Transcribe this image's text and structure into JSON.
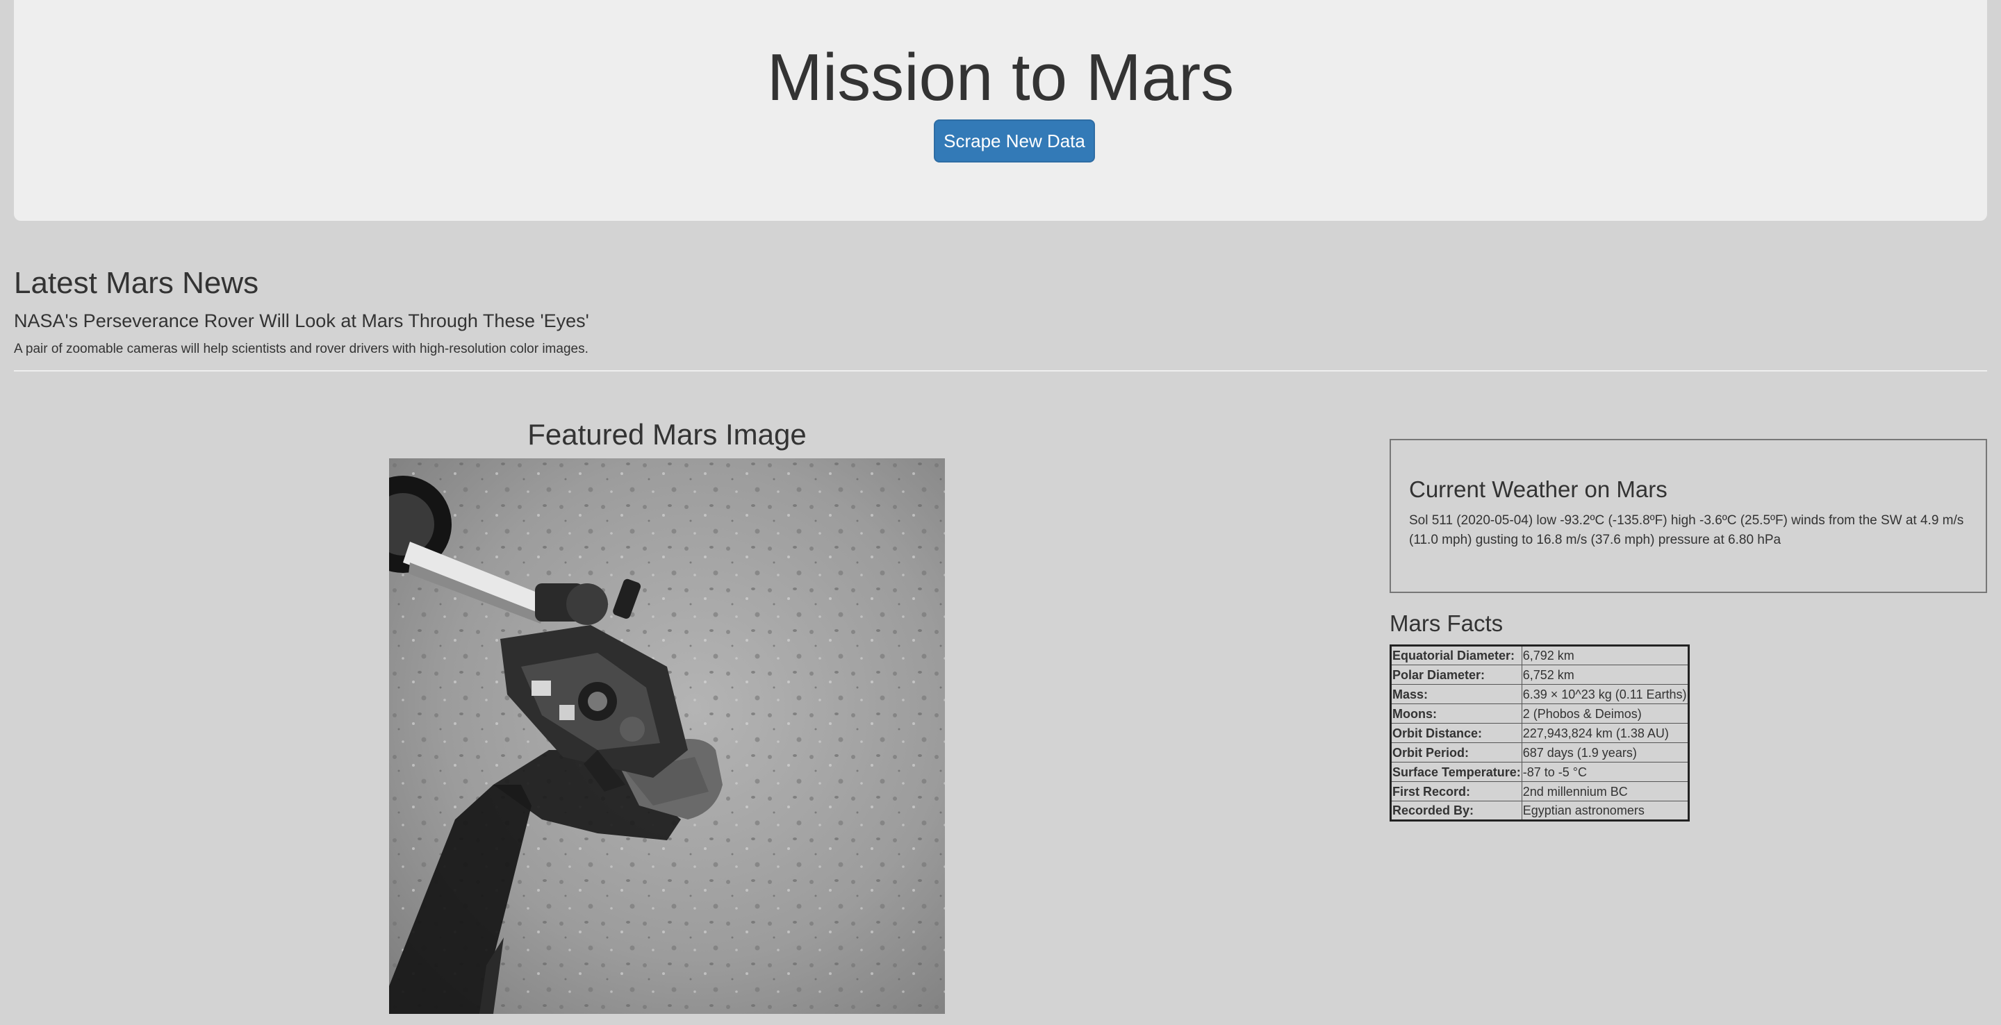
{
  "header": {
    "title": "Mission to Mars",
    "scrape_button_label": "Scrape New Data"
  },
  "news": {
    "heading": "Latest Mars News",
    "title": "NASA's Perseverance Rover Will Look at Mars Through These 'Eyes'",
    "teaser": "A pair of zoomable cameras will help scientists and rover drivers with high-resolution color images."
  },
  "featured": {
    "heading": "Featured Mars Image",
    "image_description": "grayscale rover arm over rocky ground"
  },
  "weather": {
    "heading": "Current Weather on Mars",
    "text": "Sol 511 (2020-05-04) low -93.2ºC (-135.8ºF) high -3.6ºC (25.5ºF) winds from the SW at 4.9 m/s (11.0 mph) gusting to 16.8 m/s (37.6 mph) pressure at 6.80 hPa"
  },
  "facts": {
    "heading": "Mars Facts",
    "rows": [
      {
        "label": "Equatorial Diameter:",
        "value": "6,792 km"
      },
      {
        "label": "Polar Diameter:",
        "value": "6,752 km"
      },
      {
        "label": "Mass:",
        "value": "6.39 × 10^23 kg (0.11 Earths)"
      },
      {
        "label": "Moons:",
        "value": "2 (Phobos & Deimos)"
      },
      {
        "label": "Orbit Distance:",
        "value": "227,943,824 km (1.38 AU)"
      },
      {
        "label": "Orbit Period:",
        "value": "687 days (1.9 years)"
      },
      {
        "label": "Surface Temperature:",
        "value": "-87 to -5 °C"
      },
      {
        "label": "First Record:",
        "value": "2nd millennium BC"
      },
      {
        "label": "Recorded By:",
        "value": "Egyptian astronomers"
      }
    ]
  },
  "colors": {
    "page_background": "#d3d3d3",
    "jumbotron_background": "#eeeeee",
    "button_primary": "#337ab7",
    "text": "#333333"
  }
}
